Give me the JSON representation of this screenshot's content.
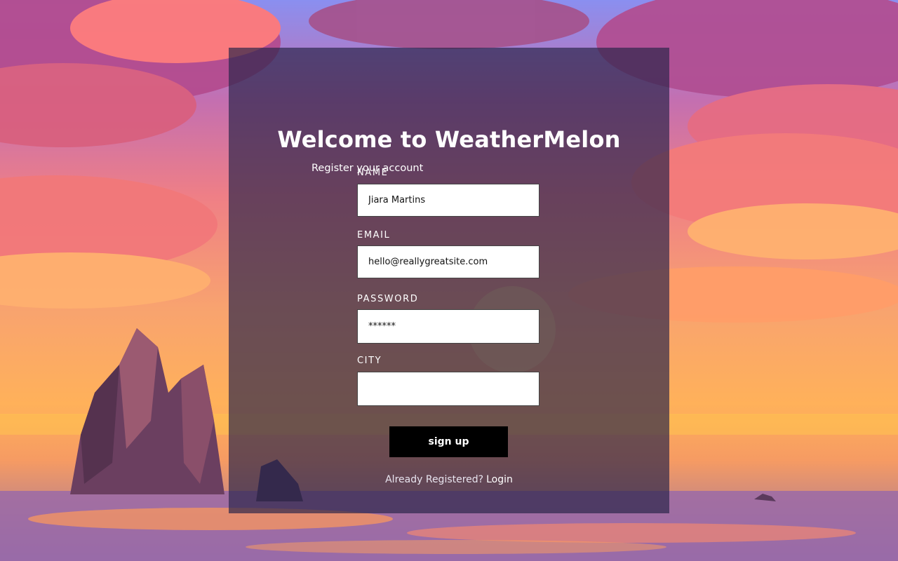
{
  "page": {
    "title": "Welcome to WeatherMelon",
    "subtitle": "Register your account"
  },
  "form": {
    "name": {
      "label": "NAME",
      "value": "Jiara Martins",
      "placeholder": ""
    },
    "email": {
      "label": "EMAIL",
      "value": "hello@reallygreatsite.com",
      "placeholder": ""
    },
    "password": {
      "label": "PASSWORD",
      "value": "******",
      "placeholder": ""
    },
    "city": {
      "label": "CITY",
      "value": "",
      "placeholder": ""
    },
    "submit_label": "sign up"
  },
  "footer": {
    "prompt": "Already Registered?",
    "login_label": "Login"
  },
  "colors": {
    "panel": "#28244A",
    "button": "#000000",
    "text": "#FFFFFF"
  },
  "background": {
    "description_icon": "sunset-seascape-illustration"
  }
}
